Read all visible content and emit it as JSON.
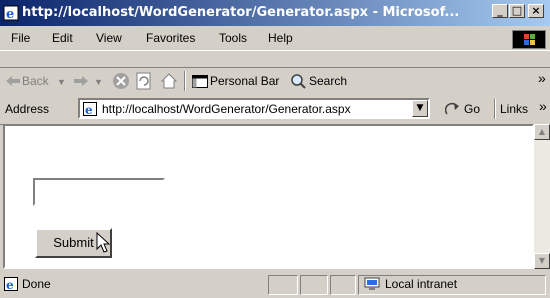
{
  "window": {
    "title": "http://localhost/WordGenerator/Generator.aspx - Microsof...",
    "minimize": "_",
    "maximize": "□",
    "close": "×"
  },
  "menubar": {
    "items": [
      "File",
      "Edit",
      "View",
      "Favorites",
      "Tools",
      "Help"
    ]
  },
  "toolbar": {
    "back_label": "Back",
    "personal_bar_label": "Personal Bar",
    "search_label": "Search",
    "overflow": "»"
  },
  "address": {
    "label": "Address",
    "url": "http://localhost/WordGenerator/Generator.aspx",
    "go_label": "Go",
    "links_label": "Links",
    "links_overflow": "»"
  },
  "page": {
    "text_input_value": "",
    "submit_label": "Submit"
  },
  "status": {
    "text": "Done",
    "zone": "Local intranet"
  },
  "colors": {
    "title_gradient_start": "#0a246a",
    "title_gradient_end": "#a6caf0",
    "chrome": "#d4d0c8"
  },
  "icons": [
    "ie-page-icon",
    "windows-logo-icon",
    "back-arrow-icon",
    "forward-arrow-icon",
    "stop-icon",
    "refresh-icon",
    "home-icon",
    "personal-bar-icon",
    "search-icon",
    "dropdown-arrow-icon",
    "go-arrow-icon",
    "intranet-icon",
    "mouse-cursor-icon"
  ]
}
